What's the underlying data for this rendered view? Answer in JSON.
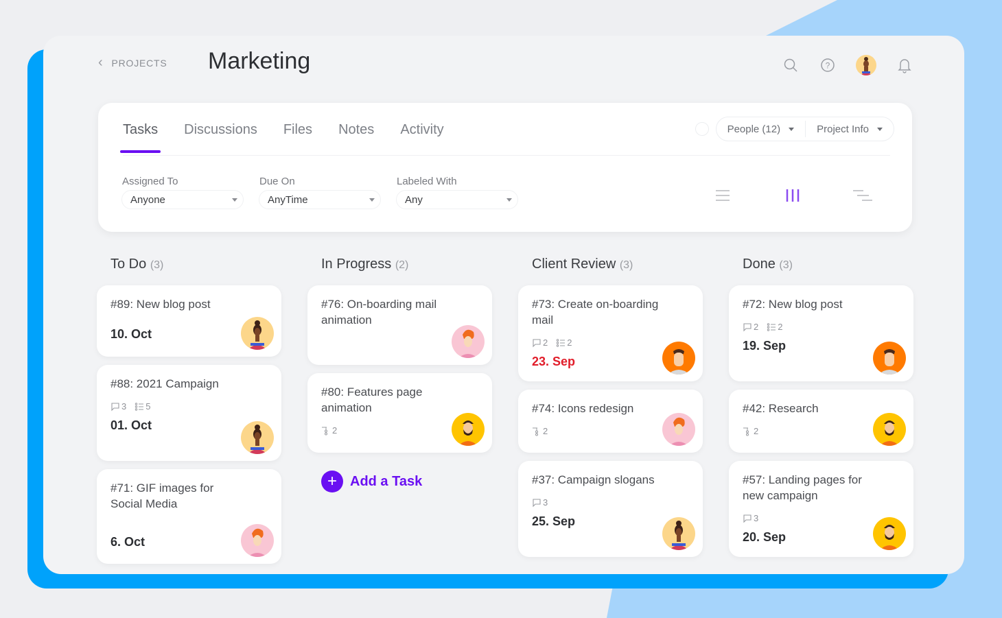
{
  "header": {
    "back_label": "PROJECTS",
    "title": "Marketing",
    "icons": [
      "search-icon",
      "help-icon",
      "user-avatar",
      "bell-icon"
    ]
  },
  "tabs": [
    {
      "label": "Tasks",
      "active": true
    },
    {
      "label": "Discussions",
      "active": false
    },
    {
      "label": "Files",
      "active": false
    },
    {
      "label": "Notes",
      "active": false
    },
    {
      "label": "Activity",
      "active": false
    }
  ],
  "panel_actions": {
    "people_label": "People (12)",
    "project_info_label": "Project Info"
  },
  "filters": [
    {
      "label": "Assigned To",
      "value": "Anyone"
    },
    {
      "label": "Due On",
      "value": "AnyTime"
    },
    {
      "label": "Labeled With",
      "value": "Any"
    }
  ],
  "view_modes": [
    "list-view",
    "board-view",
    "timeline-view"
  ],
  "active_view": "board-view",
  "colors": {
    "accent": "#6a0ff2",
    "overdue": "#e11d2a",
    "frame_blue": "#00a2fb",
    "bg_blue": "#a6d4fb"
  },
  "columns": [
    {
      "title": "To Do",
      "count": "(3)",
      "cards": [
        {
          "title": "#89: New blog post",
          "comments": null,
          "checklist": null,
          "subtasks": null,
          "date": "10. Oct",
          "overdue": false,
          "avatar": "woman-bun"
        },
        {
          "title": "#88: 2021 Campaign",
          "comments": "3",
          "checklist": "5",
          "subtasks": null,
          "date": "01. Oct",
          "overdue": false,
          "avatar": "woman-bun"
        },
        {
          "title": "#71: GIF images for Social Media",
          "comments": null,
          "checklist": null,
          "subtasks": null,
          "date": "6. Oct",
          "overdue": false,
          "avatar": "redhead"
        }
      ]
    },
    {
      "title": "In Progress",
      "count": "(2)",
      "cards": [
        {
          "title": "#76: On-boarding mail animation",
          "comments": null,
          "checklist": null,
          "subtasks": null,
          "date": null,
          "overdue": false,
          "avatar": "redhead"
        },
        {
          "title": "#80: Features page animation",
          "comments": null,
          "checklist": null,
          "subtasks": "2",
          "date": null,
          "overdue": false,
          "avatar": "bearded"
        }
      ],
      "add_task_label": "Add a Task"
    },
    {
      "title": "Client Review",
      "count": "(3)",
      "cards": [
        {
          "title": "#73: Create on-boarding mail",
          "comments": "2",
          "checklist": "2",
          "subtasks": null,
          "date": "23. Sep",
          "overdue": true,
          "avatar": "orange-man"
        },
        {
          "title": "#74: Icons redesign",
          "comments": null,
          "checklist": null,
          "subtasks": "2",
          "date": null,
          "overdue": false,
          "avatar": "redhead"
        },
        {
          "title": "#37: Campaign slogans",
          "comments": "3",
          "checklist": null,
          "subtasks": null,
          "date": "25. Sep",
          "overdue": false,
          "avatar": "woman-bun"
        }
      ]
    },
    {
      "title": "Done",
      "count": "(3)",
      "cards": [
        {
          "title": "#72: New blog post",
          "comments": "2",
          "checklist": "2",
          "subtasks": null,
          "date": "19. Sep",
          "overdue": false,
          "avatar": "orange-man"
        },
        {
          "title": "#42: Research",
          "comments": null,
          "checklist": null,
          "subtasks": "2",
          "date": null,
          "overdue": false,
          "avatar": "bearded"
        },
        {
          "title": "#57: Landing pages for new campaign",
          "comments": "3",
          "checklist": null,
          "subtasks": null,
          "date": "20. Sep",
          "overdue": false,
          "avatar": "bearded"
        }
      ]
    }
  ]
}
